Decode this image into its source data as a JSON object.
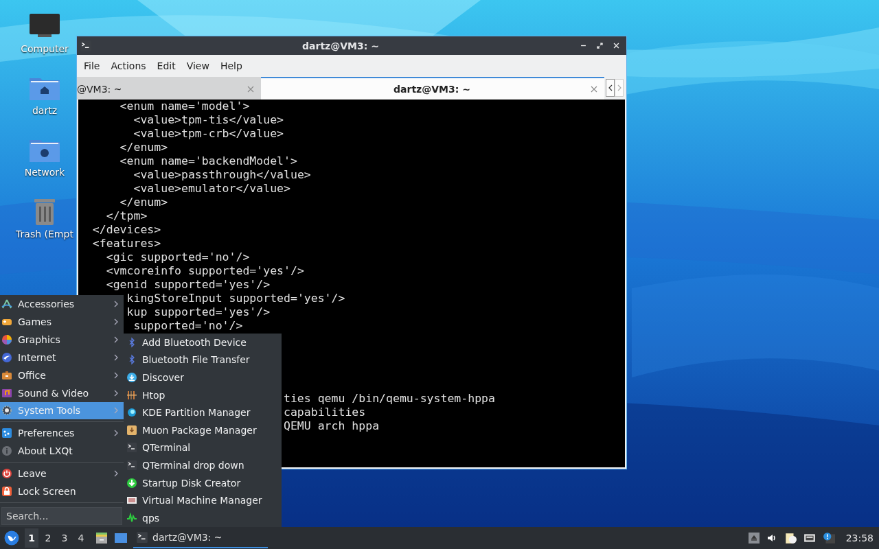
{
  "desktop_icons": [
    {
      "label": "Computer",
      "kind": "computer"
    },
    {
      "label": "dartz",
      "kind": "home"
    },
    {
      "label": "Network",
      "kind": "network"
    },
    {
      "label": "Trash (Empt",
      "kind": "trash"
    }
  ],
  "terminal": {
    "title": "dartz@VM3: ~",
    "menu": [
      "File",
      "Actions",
      "Edit",
      "View",
      "Help"
    ],
    "tabs": [
      {
        "label": "@VM3: ~",
        "selected": false
      },
      {
        "label": "dartz@VM3: ~",
        "selected": true
      }
    ],
    "blocks": [
      [
        "      <enum name='model'>",
        "        <value>tpm-tis</value>",
        "        <value>tpm-crb</value>",
        "      </enum>",
        "      <enum name='backendModel'>",
        "        <value>passthrough</value>",
        "        <value>emulator</value>",
        "      </enum>",
        "    </tpm>",
        "  </devices>",
        "  <features>",
        "    <gic supported='no'/>",
        "    <vmcoreinfo supported='yes'/>",
        "    <genid supported='yes'/>",
        "       kingStoreInput supported='yes'/>",
        "       kup supported='yes'/>",
        "        supported='no'/>"
      ],
      [
        "                              ties qemu /bin/qemu-system-hppa",
        "                              capabilities",
        "                              QEMU arch hppa"
      ]
    ]
  },
  "app_menu": {
    "groups": [
      [
        {
          "label": "Accessories",
          "kind": "accessories",
          "has_submenu": true,
          "selected": false
        },
        {
          "label": "Games",
          "kind": "games",
          "has_submenu": true,
          "selected": false
        },
        {
          "label": "Graphics",
          "kind": "graphics",
          "has_submenu": true,
          "selected": false
        },
        {
          "label": "Internet",
          "kind": "internet",
          "has_submenu": true,
          "selected": false
        },
        {
          "label": "Office",
          "kind": "office",
          "has_submenu": true,
          "selected": false
        },
        {
          "label": "Sound & Video",
          "kind": "media",
          "has_submenu": true,
          "selected": false
        },
        {
          "label": "System Tools",
          "kind": "system",
          "has_submenu": true,
          "selected": true
        }
      ],
      [
        {
          "label": "Preferences",
          "kind": "preferences",
          "has_submenu": true,
          "selected": false
        },
        {
          "label": "About LXQt",
          "kind": "about",
          "has_submenu": false,
          "selected": false
        }
      ],
      [
        {
          "label": "Leave",
          "kind": "leave",
          "has_submenu": true,
          "selected": false
        },
        {
          "label": "Lock Screen",
          "kind": "lock",
          "has_submenu": false,
          "selected": false
        }
      ]
    ],
    "search": {
      "placeholder": "Search..."
    }
  },
  "submenu": {
    "items": [
      {
        "label": "Add Bluetooth Device",
        "kind": "bluetooth"
      },
      {
        "label": "Bluetooth File Transfer",
        "kind": "bluetooth"
      },
      {
        "label": "Discover",
        "kind": "discover"
      },
      {
        "label": "Htop",
        "kind": "htop"
      },
      {
        "label": "KDE Partition Manager",
        "kind": "partition"
      },
      {
        "label": "Muon Package Manager",
        "kind": "package"
      },
      {
        "label": "QTerminal",
        "kind": "terminal"
      },
      {
        "label": "QTerminal drop down",
        "kind": "terminal"
      },
      {
        "label": "Startup Disk Creator",
        "kind": "startup"
      },
      {
        "label": "Virtual Machine Manager",
        "kind": "vm"
      },
      {
        "label": "qps",
        "kind": "qps"
      }
    ]
  },
  "taskbar": {
    "desktops": [
      {
        "label": "1",
        "selected": true
      },
      {
        "label": "2",
        "selected": false
      },
      {
        "label": "3",
        "selected": false
      },
      {
        "label": "4",
        "selected": false
      }
    ],
    "tasks": [
      {
        "label": "dartz@VM3: ~",
        "selected": true
      }
    ],
    "clock": "23:58"
  }
}
